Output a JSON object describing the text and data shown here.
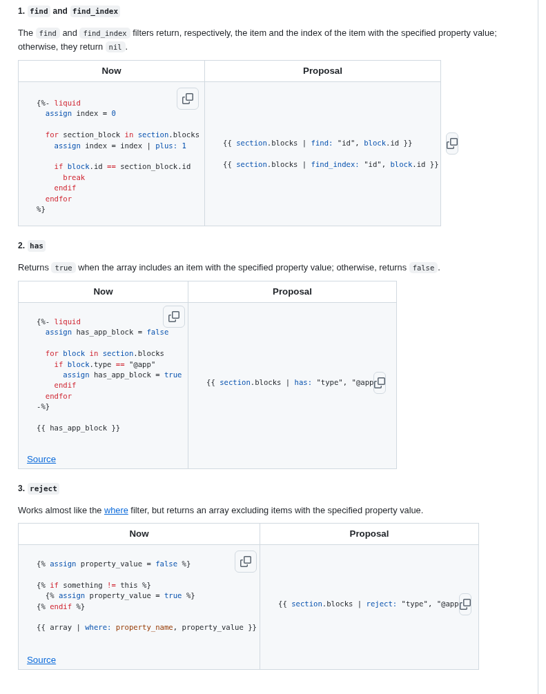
{
  "sections": [
    {
      "heading": [
        {
          "kind": "text",
          "text": "1."
        },
        {
          "kind": "code",
          "text": "find"
        },
        {
          "kind": "text",
          "text": "and"
        },
        {
          "kind": "code",
          "text": "find_index"
        }
      ],
      "description": [
        {
          "kind": "text",
          "text": "The "
        },
        {
          "kind": "code",
          "text": "find"
        },
        {
          "kind": "text",
          "text": " and "
        },
        {
          "kind": "code",
          "text": "find_index"
        },
        {
          "kind": "text",
          "text": " filters return, respectively, the item and the index of the item with the specified property value; otherwise, they return "
        },
        {
          "kind": "code",
          "text": "nil"
        },
        {
          "kind": "text",
          "text": "."
        }
      ],
      "table": {
        "columns": [
          "Now",
          "Proposal"
        ],
        "now": {
          "groups": [
            [
              [
                {
                  "kind": "plain",
                  "text": "{%- "
                },
                {
                  "kind": "keyword",
                  "text": "liquid"
                }
              ],
              [
                {
                  "kind": "entity",
                  "text": "  assign"
                },
                {
                  "kind": "plain",
                  "text": " index = "
                },
                {
                  "kind": "entity",
                  "text": "0"
                }
              ]
            ],
            [
              [
                {
                  "kind": "keyword",
                  "text": "  for"
                },
                {
                  "kind": "plain",
                  "text": " section_block "
                },
                {
                  "kind": "keyword",
                  "text": "in"
                },
                {
                  "kind": "entity",
                  "text": " section"
                },
                {
                  "kind": "plain",
                  "text": ".blocks"
                }
              ],
              [
                {
                  "kind": "entity",
                  "text": "    assign"
                },
                {
                  "kind": "plain",
                  "text": " index = index | "
                },
                {
                  "kind": "entity",
                  "text": "plus:"
                },
                {
                  "kind": "entity",
                  "text": " 1"
                }
              ]
            ],
            [
              [
                {
                  "kind": "keyword",
                  "text": "    if"
                },
                {
                  "kind": "entity",
                  "text": " block"
                },
                {
                  "kind": "plain",
                  "text": ".id "
                },
                {
                  "kind": "keyword",
                  "text": "=="
                },
                {
                  "kind": "plain",
                  "text": " section_block.id"
                }
              ],
              [
                {
                  "kind": "keyword",
                  "text": "      break"
                }
              ],
              [
                {
                  "kind": "keyword",
                  "text": "    endif"
                }
              ],
              [
                {
                  "kind": "keyword",
                  "text": "  endfor"
                }
              ],
              [
                {
                  "kind": "plain",
                  "text": "%}"
                }
              ]
            ]
          ]
        },
        "proposal": {
          "groups": [
            [
              [
                {
                  "kind": "plain",
                  "text": "{{ "
                },
                {
                  "kind": "entity",
                  "text": "section"
                },
                {
                  "kind": "plain",
                  "text": ".blocks | "
                },
                {
                  "kind": "entity",
                  "text": "find:"
                },
                {
                  "kind": "plain",
                  "text": " \"id\", "
                },
                {
                  "kind": "entity",
                  "text": "block"
                },
                {
                  "kind": "plain",
                  "text": ".id }}"
                }
              ]
            ],
            [
              [
                {
                  "kind": "plain",
                  "text": "{{ "
                },
                {
                  "kind": "entity",
                  "text": "section"
                },
                {
                  "kind": "plain",
                  "text": ".blocks | "
                },
                {
                  "kind": "entity",
                  "text": "find_index:"
                },
                {
                  "kind": "plain",
                  "text": " \"id\", "
                },
                {
                  "kind": "entity",
                  "text": "block"
                },
                {
                  "kind": "plain",
                  "text": ".id }}"
                }
              ]
            ]
          ]
        }
      }
    },
    {
      "heading": [
        {
          "kind": "text",
          "text": "2."
        },
        {
          "kind": "code",
          "text": "has"
        }
      ],
      "description": [
        {
          "kind": "text",
          "text": "Returns "
        },
        {
          "kind": "code",
          "text": "true"
        },
        {
          "kind": "text",
          "text": " when the array includes an item with the specified property value; otherwise, returns "
        },
        {
          "kind": "code",
          "text": "false"
        },
        {
          "kind": "text",
          "text": "."
        }
      ],
      "table": {
        "columns": [
          "Now",
          "Proposal"
        ],
        "now": {
          "groups": [
            [
              [
                {
                  "kind": "plain",
                  "text": "{%- "
                },
                {
                  "kind": "keyword",
                  "text": "liquid"
                }
              ],
              [
                {
                  "kind": "entity",
                  "text": "  assign"
                },
                {
                  "kind": "plain",
                  "text": " has_app_block = "
                },
                {
                  "kind": "entity",
                  "text": "false"
                }
              ]
            ],
            [
              [
                {
                  "kind": "keyword",
                  "text": "  for"
                },
                {
                  "kind": "entity",
                  "text": " block"
                },
                {
                  "kind": "keyword",
                  "text": " in"
                },
                {
                  "kind": "entity",
                  "text": " section"
                },
                {
                  "kind": "plain",
                  "text": ".blocks"
                }
              ],
              [
                {
                  "kind": "keyword",
                  "text": "    if"
                },
                {
                  "kind": "entity",
                  "text": " block"
                },
                {
                  "kind": "plain",
                  "text": ".type "
                },
                {
                  "kind": "keyword",
                  "text": "=="
                },
                {
                  "kind": "plain",
                  "text": " \"@app\""
                }
              ],
              [
                {
                  "kind": "entity",
                  "text": "      assign"
                },
                {
                  "kind": "plain",
                  "text": " has_app_block = "
                },
                {
                  "kind": "entity",
                  "text": "true"
                }
              ],
              [
                {
                  "kind": "keyword",
                  "text": "    endif"
                }
              ],
              [
                {
                  "kind": "keyword",
                  "text": "  endfor"
                }
              ],
              [
                {
                  "kind": "plain",
                  "text": "-%}"
                }
              ]
            ],
            [
              [
                {
                  "kind": "plain",
                  "text": "{{ has_app_block }}"
                }
              ]
            ]
          ],
          "source_link": "Source"
        },
        "proposal": {
          "groups": [
            [
              [
                {
                  "kind": "plain",
                  "text": "{{ "
                },
                {
                  "kind": "entity",
                  "text": "section"
                },
                {
                  "kind": "plain",
                  "text": ".blocks | "
                },
                {
                  "kind": "entity",
                  "text": "has:"
                },
                {
                  "kind": "plain",
                  "text": " \"type\", \"@app"
                }
              ]
            ]
          ]
        }
      }
    },
    {
      "heading": [
        {
          "kind": "text",
          "text": "3."
        },
        {
          "kind": "code",
          "text": "reject"
        }
      ],
      "description": [
        {
          "kind": "text",
          "text": "Works almost like the "
        },
        {
          "kind": "link",
          "text": "where"
        },
        {
          "kind": "text",
          "text": " filter, but returns an array excluding items with the specified property value."
        }
      ],
      "table": {
        "columns": [
          "Now",
          "Proposal"
        ],
        "now": {
          "groups": [
            [
              [
                {
                  "kind": "plain",
                  "text": "{% "
                },
                {
                  "kind": "entity",
                  "text": "assign"
                },
                {
                  "kind": "plain",
                  "text": " property_value = "
                },
                {
                  "kind": "entity",
                  "text": "false"
                },
                {
                  "kind": "plain",
                  "text": " %}"
                }
              ]
            ],
            [
              [
                {
                  "kind": "plain",
                  "text": "{% "
                },
                {
                  "kind": "keyword",
                  "text": "if"
                },
                {
                  "kind": "plain",
                  "text": " something "
                },
                {
                  "kind": "keyword",
                  "text": "!="
                },
                {
                  "kind": "plain",
                  "text": " this %}"
                }
              ],
              [
                {
                  "kind": "plain",
                  "text": "  {% "
                },
                {
                  "kind": "entity",
                  "text": "assign"
                },
                {
                  "kind": "plain",
                  "text": " property_value = "
                },
                {
                  "kind": "entity",
                  "text": "true"
                },
                {
                  "kind": "plain",
                  "text": " %}"
                }
              ],
              [
                {
                  "kind": "plain",
                  "text": "{% "
                },
                {
                  "kind": "keyword",
                  "text": "endif"
                },
                {
                  "kind": "plain",
                  "text": " %}"
                }
              ]
            ],
            [
              [
                {
                  "kind": "plain",
                  "text": "{{ array | "
                },
                {
                  "kind": "entity",
                  "text": "where:"
                },
                {
                  "kind": "variable",
                  "text": " property_name"
                },
                {
                  "kind": "plain",
                  "text": ", property_value }}"
                }
              ]
            ]
          ],
          "source_link": "Source"
        },
        "proposal": {
          "groups": [
            [
              [
                {
                  "kind": "plain",
                  "text": "{{ "
                },
                {
                  "kind": "entity",
                  "text": "section"
                },
                {
                  "kind": "plain",
                  "text": ".blocks | "
                },
                {
                  "kind": "entity",
                  "text": "reject:"
                },
                {
                  "kind": "plain",
                  "text": " \"type\", \"@app"
                }
              ]
            ]
          ]
        }
      }
    }
  ]
}
